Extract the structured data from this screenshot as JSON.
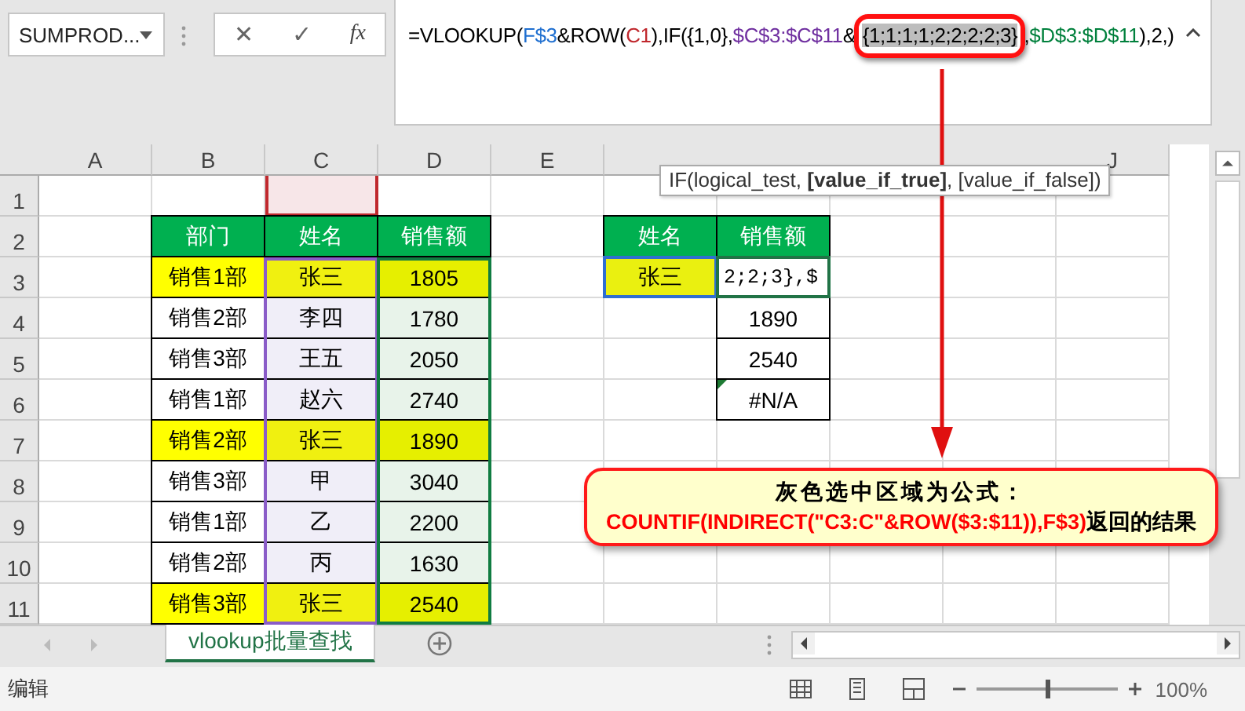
{
  "name_box": {
    "value": "SUMPROD..."
  },
  "formula_buttons": [
    "✕",
    "✓",
    "fx"
  ],
  "formula": [
    {
      "text": "=VLOOKUP(",
      "color": "#000000",
      "highlighted": false
    },
    {
      "text": "F$3",
      "color": "#1f6fd0",
      "highlighted": false
    },
    {
      "text": "&ROW(",
      "color": "#000000",
      "highlighted": false
    },
    {
      "text": "C1",
      "color": "#c0282d",
      "highlighted": false
    },
    {
      "text": "),IF(",
      "color": "#000000",
      "highlighted": false
    },
    {
      "text": "{1,0},",
      "color": "#000000",
      "highlighted": false
    },
    {
      "text": "$C$3:$C$11",
      "color": "#7030a0",
      "highlighted": false
    },
    {
      "text": "&",
      "color": "#000000",
      "highlighted": false
    },
    {
      "text": "{1;1;1;1;2;2;2;2;3}",
      "color": "#000000",
      "highlighted": true
    },
    {
      "text": ",",
      "color": "#000000",
      "highlighted": false
    },
    {
      "text": "$D$3:$D$11",
      "color": "#00803c",
      "highlighted": false
    },
    {
      "text": "),2,)",
      "color": "#000000",
      "highlighted": false
    }
  ],
  "tooltip": "IF(logical_test, **[value_if_true]**, [value_if_false])",
  "column_headers": [
    "A",
    "B",
    "C",
    "D",
    "E"
  ],
  "column_headers_right": [
    "J"
  ],
  "row_headers": [
    "1",
    "2",
    "3",
    "4",
    "5",
    "6",
    "7",
    "8",
    "9",
    "10",
    "11"
  ],
  "left_table": {
    "headers": [
      "部门",
      "姓名",
      "销售额"
    ],
    "rows": [
      {
        "dept": "销售1部",
        "name": "张三",
        "sales": "1805",
        "highlighted": true
      },
      {
        "dept": "销售2部",
        "name": "李四",
        "sales": "1780",
        "highlighted": false
      },
      {
        "dept": "销售3部",
        "name": "王五",
        "sales": "2050",
        "highlighted": false
      },
      {
        "dept": "销售1部",
        "name": "赵六",
        "sales": "2740",
        "highlighted": false
      },
      {
        "dept": "销售2部",
        "name": "张三",
        "sales": "1890",
        "highlighted": true
      },
      {
        "dept": "销售3部",
        "name": "甲",
        "sales": "3040",
        "highlighted": false
      },
      {
        "dept": "销售1部",
        "name": "乙",
        "sales": "2200",
        "highlighted": false
      },
      {
        "dept": "销售2部",
        "name": "丙",
        "sales": "1630",
        "highlighted": false
      },
      {
        "dept": "销售3部",
        "name": "张三",
        "sales": "2540",
        "highlighted": true
      }
    ]
  },
  "right_table": {
    "headers": [
      "姓名",
      "销售额"
    ],
    "rows": [
      {
        "name": "张三",
        "selected": true,
        "sales": "2;2;3},$",
        "editing": true,
        "error": false
      },
      {
        "sales": "1890",
        "editing": false,
        "error": false
      },
      {
        "sales": "2540",
        "editing": false,
        "error": false
      },
      {
        "sales": "#N/A",
        "editing": false,
        "error": true
      }
    ]
  },
  "callout": {
    "title": "灰色选中区域为公式：",
    "formula": "COUNTIF(INDIRECT(\"C3:C\"&ROW($3:$11)),F$3)",
    "suffix": "返回的结果"
  },
  "sheet_tabs": [
    {
      "label": "vlookup批量查找",
      "selected": true
    }
  ],
  "status_bar": {
    "mode": "编辑",
    "zoom_slider": {
      "level": 0.5
    },
    "zoom": "100%"
  }
}
